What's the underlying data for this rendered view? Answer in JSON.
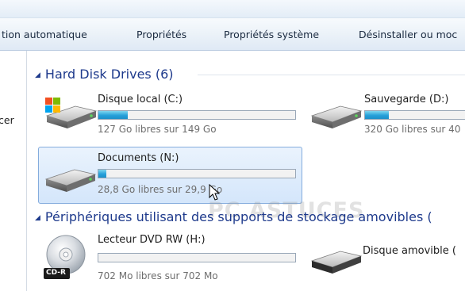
{
  "toolbar": {
    "items": [
      "tion automatique",
      "Propriétés",
      "Propriétés système",
      "Désinstaller ou moc"
    ]
  },
  "left_pane": {
    "label": "cer"
  },
  "groups": {
    "hdd": {
      "title": "Hard Disk Drives (6)",
      "drives": [
        {
          "name": "Disque local (C:)",
          "free_text": "127 Go libres sur 149 Go",
          "used_fraction": 0.15
        },
        {
          "name": "Sauvegarde (D:)",
          "free_text": "320 Go libres sur 40",
          "used_fraction": 0.2
        },
        {
          "name": "Documents (N:)",
          "free_text": "28,8 Go libres sur 29,9 Go",
          "used_fraction": 0.04
        }
      ]
    },
    "removable": {
      "title": "Périphériques utilisant des supports de stockage amovibles (",
      "drives": [
        {
          "name": "Lecteur DVD RW (H:)",
          "free_text": "702 Mo libres sur 702 Mo",
          "used_fraction": 0.0,
          "badge": "CD-R"
        },
        {
          "name": "Disque amovible ("
        }
      ]
    }
  },
  "watermark": "PC ASTUCES",
  "colors": {
    "accent_header": "#1e3a8c",
    "bar_fill": "#26a0da",
    "selection": "#d4e6fb"
  }
}
